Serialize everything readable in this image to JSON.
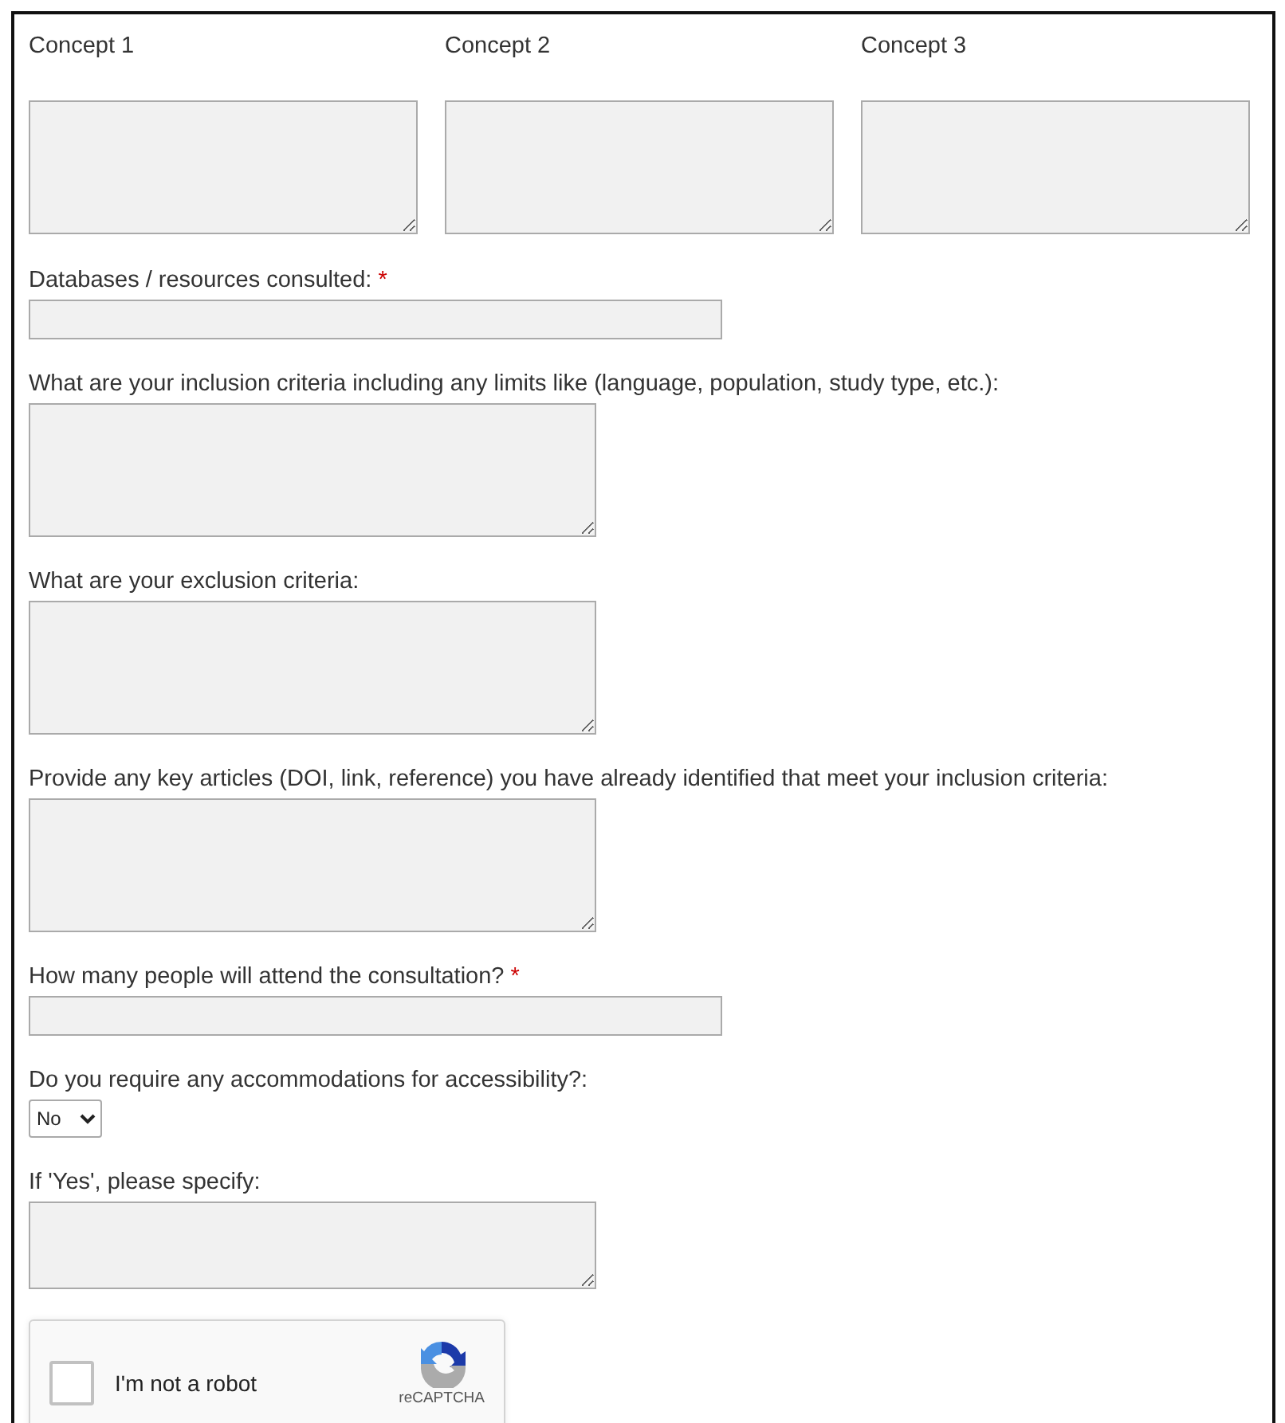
{
  "concepts": [
    {
      "label": "Concept 1"
    },
    {
      "label": "Concept 2"
    },
    {
      "label": "Concept 3"
    }
  ],
  "fields": [
    {
      "kind": "text",
      "label": "Databases / resources consulted:",
      "required_mark": "*"
    },
    {
      "kind": "textarea",
      "label": "What are your inclusion criteria including any limits like (language, population, study type, etc.):"
    },
    {
      "kind": "textarea",
      "label": "What are your exclusion criteria:"
    },
    {
      "kind": "textarea",
      "label": "Provide any key articles (DOI, link, reference) you have already identified that meet your inclusion criteria:"
    },
    {
      "kind": "text",
      "label": "How many people will attend the consultation?",
      "required_mark": "*"
    },
    {
      "kind": "select",
      "label": "Do you require any accommodations for accessibility?:",
      "value": "No"
    },
    {
      "kind": "shorttextarea",
      "label": "If 'Yes', please specify:"
    }
  ],
  "captcha": {
    "label": "I'm not a robot",
    "checked": false,
    "brand": "reCAPTCHA"
  }
}
